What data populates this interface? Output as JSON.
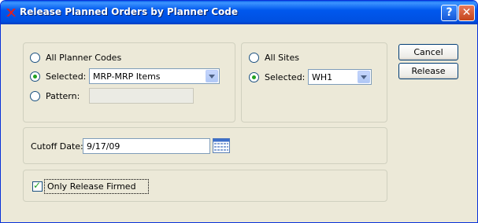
{
  "window": {
    "title": "Release Planned Orders by Planner Code",
    "help_label": "?",
    "close_label": "✕"
  },
  "planner": {
    "all_label": "All Planner Codes",
    "selected_label": "Selected:",
    "selected_value": "MRP-MRP Items",
    "pattern_label": "Pattern:",
    "pattern_value": "",
    "choice": "selected"
  },
  "sites": {
    "all_label": "All Sites",
    "selected_label": "Selected:",
    "selected_value": "WH1",
    "choice": "selected"
  },
  "cutoff": {
    "label": "Cutoff Date:",
    "value": "9/17/09"
  },
  "firmed": {
    "label": "Only Release Firmed",
    "checked": true
  },
  "buttons": {
    "cancel_label": "Cancel",
    "release_label": "Release"
  },
  "icons": {
    "app": "app-logo-icon",
    "calendar": "calendar-icon"
  }
}
